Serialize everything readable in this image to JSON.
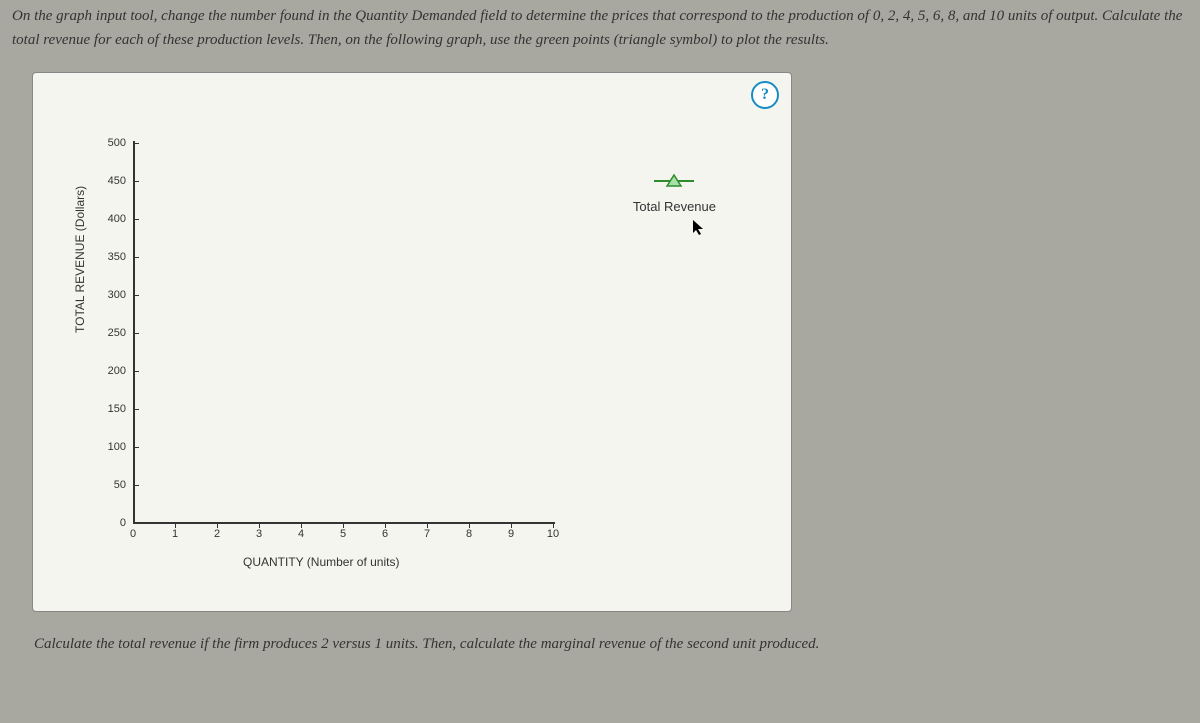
{
  "instructions_top": "On the graph input tool, change the number found in the Quantity Demanded field to determine the prices that correspond to the production of 0, 2, 4, 5, 6, 8, and 10 units of output. Calculate the total revenue for each of these production levels. Then, on the following graph, use the green points (triangle symbol) to plot the results.",
  "instructions_bottom": "Calculate the total revenue if the firm produces 2 versus 1 units. Then, calculate the marginal revenue of the second unit produced.",
  "help_label": "?",
  "legend": {
    "label": "Total Revenue",
    "color": "#2e8b2e"
  },
  "chart_data": {
    "type": "scatter",
    "title": "",
    "xlabel": "QUANTITY (Number of units)",
    "ylabel": "TOTAL REVENUE (Dollars)",
    "x_ticks": [
      0,
      1,
      2,
      3,
      4,
      5,
      6,
      7,
      8,
      9,
      10
    ],
    "y_ticks": [
      0,
      50,
      100,
      150,
      200,
      250,
      300,
      350,
      400,
      450,
      500
    ],
    "xlim": [
      0,
      10
    ],
    "ylim": [
      0,
      500
    ],
    "series": [
      {
        "name": "Total Revenue",
        "marker": "triangle",
        "color": "#2e8b2e",
        "x": [],
        "y": []
      }
    ]
  }
}
